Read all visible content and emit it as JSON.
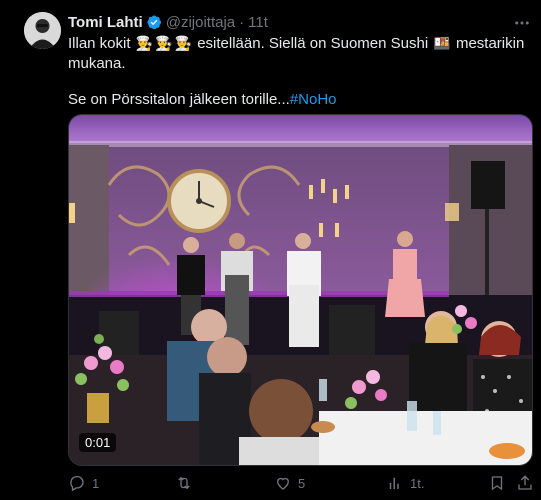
{
  "author": {
    "name": "Tomi Lahti",
    "handle": "@zijoittaja",
    "time": "11t",
    "verified": true
  },
  "tweet": {
    "line1_pre": "Illan kokit",
    "line1_post": "esitellään. Siellä on Suomen Sushi",
    "line1_end": "mestarikin",
    "line2": "mukana.",
    "line3_pre": "Se on Pörssitalon jälkeen torille...",
    "hashtag": "#NoHo",
    "chef_emoji": "👨‍🍳",
    "sushi_emoji": "🍱"
  },
  "media": {
    "type": "video",
    "timestamp": "0:01"
  },
  "actions": {
    "replies": "1",
    "retweets": "",
    "likes": "5",
    "views": "1t."
  },
  "colors": {
    "background": "#000000",
    "text": "#e7e9ea",
    "secondary": "#71767b",
    "link": "#1d9bf0",
    "verified": "#1d9bf0"
  }
}
